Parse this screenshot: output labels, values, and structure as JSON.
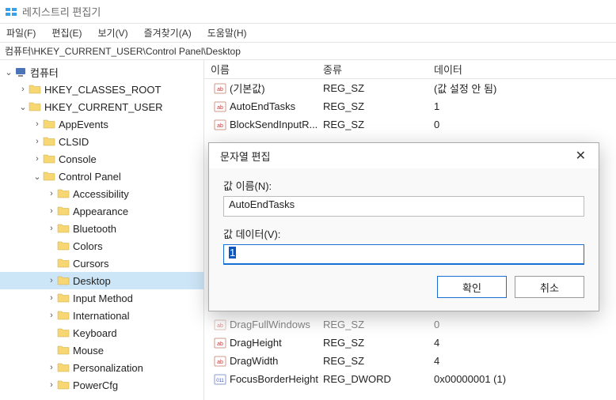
{
  "title": "레지스트리 편집기",
  "menubar": {
    "file": "파일(F)",
    "edit": "편집(E)",
    "view": "보기(V)",
    "favorites": "즐겨찾기(A)",
    "help": "도움말(H)"
  },
  "address": "컴퓨터\\HKEY_CURRENT_USER\\Control Panel\\Desktop",
  "tree": [
    {
      "label": "컴퓨터",
      "indent": 0,
      "icon": "pc",
      "twisty": "open"
    },
    {
      "label": "HKEY_CLASSES_ROOT",
      "indent": 1,
      "icon": "folder",
      "twisty": "closed"
    },
    {
      "label": "HKEY_CURRENT_USER",
      "indent": 1,
      "icon": "folder",
      "twisty": "open"
    },
    {
      "label": "AppEvents",
      "indent": 2,
      "icon": "folder",
      "twisty": "closed"
    },
    {
      "label": "CLSID",
      "indent": 2,
      "icon": "folder",
      "twisty": "closed"
    },
    {
      "label": "Console",
      "indent": 2,
      "icon": "folder",
      "twisty": "closed"
    },
    {
      "label": "Control Panel",
      "indent": 2,
      "icon": "folder",
      "twisty": "open"
    },
    {
      "label": "Accessibility",
      "indent": 3,
      "icon": "folder",
      "twisty": "closed"
    },
    {
      "label": "Appearance",
      "indent": 3,
      "icon": "folder",
      "twisty": "closed"
    },
    {
      "label": "Bluetooth",
      "indent": 3,
      "icon": "folder",
      "twisty": "closed"
    },
    {
      "label": "Colors",
      "indent": 3,
      "icon": "folder",
      "twisty": "none"
    },
    {
      "label": "Cursors",
      "indent": 3,
      "icon": "folder",
      "twisty": "none"
    },
    {
      "label": "Desktop",
      "indent": 3,
      "icon": "folder",
      "twisty": "closed",
      "selected": true
    },
    {
      "label": "Input Method",
      "indent": 3,
      "icon": "folder",
      "twisty": "closed"
    },
    {
      "label": "International",
      "indent": 3,
      "icon": "folder",
      "twisty": "closed"
    },
    {
      "label": "Keyboard",
      "indent": 3,
      "icon": "folder",
      "twisty": "none"
    },
    {
      "label": "Mouse",
      "indent": 3,
      "icon": "folder",
      "twisty": "none"
    },
    {
      "label": "Personalization",
      "indent": 3,
      "icon": "folder",
      "twisty": "closed"
    },
    {
      "label": "PowerCfg",
      "indent": 3,
      "icon": "folder",
      "twisty": "closed"
    }
  ],
  "list_headers": {
    "name": "이름",
    "type": "종류",
    "data": "데이터"
  },
  "values": [
    {
      "name": "(기본값)",
      "type": "REG_SZ",
      "data": "(값 설정 안 됨)",
      "icon": "str"
    },
    {
      "name": "AutoEndTasks",
      "type": "REG_SZ",
      "data": "1",
      "icon": "str"
    },
    {
      "name": "BlockSendInputR...",
      "type": "REG_SZ",
      "data": "0",
      "icon": "str"
    },
    {
      "name": "DragFullWindows",
      "type": "REG_SZ",
      "data": "0",
      "icon": "str",
      "dimmed": true
    },
    {
      "name": "DragHeight",
      "type": "REG_SZ",
      "data": "4",
      "icon": "str"
    },
    {
      "name": "DragWidth",
      "type": "REG_SZ",
      "data": "4",
      "icon": "str"
    },
    {
      "name": "FocusBorderHeight",
      "type": "REG_DWORD",
      "data": "0x00000001 (1)",
      "icon": "bin"
    }
  ],
  "dialog": {
    "title": "문자열 편집",
    "name_label": "값 이름(N):",
    "name_value": "AutoEndTasks",
    "data_label": "값 데이터(V):",
    "data_value": "1",
    "ok": "확인",
    "cancel": "취소"
  }
}
